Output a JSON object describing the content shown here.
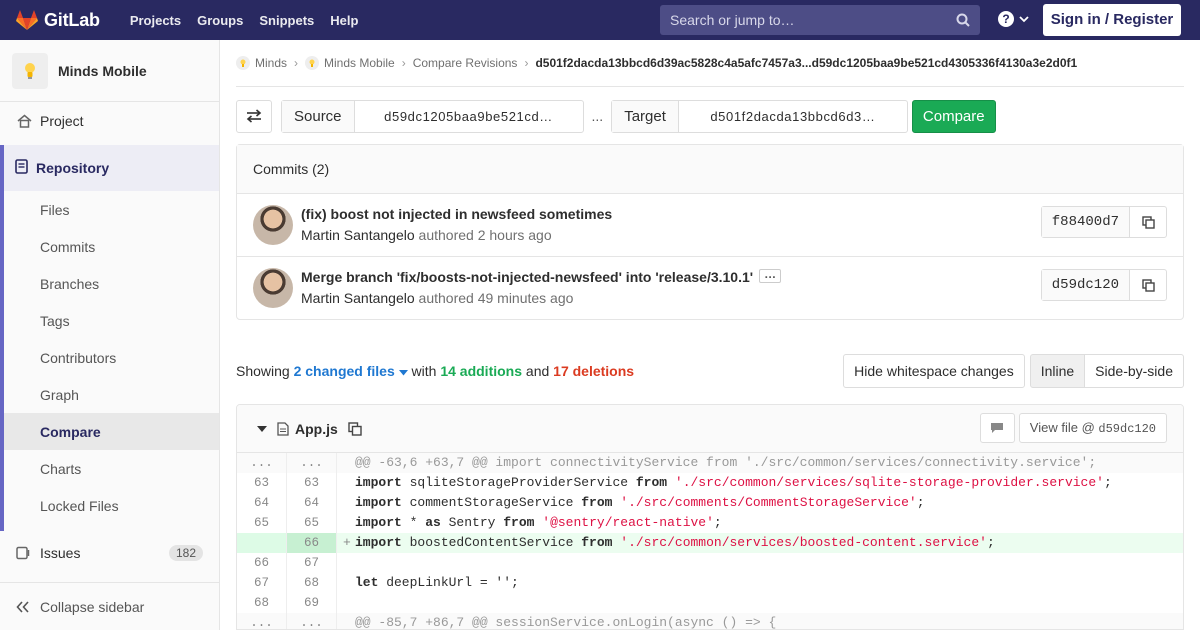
{
  "topbar": {
    "brand": "GitLab",
    "nav": [
      "Projects",
      "Groups",
      "Snippets",
      "Help"
    ],
    "search_placeholder": "Search or jump to…",
    "signin": "Sign in / Register"
  },
  "sidebar": {
    "project_name": "Minds Mobile",
    "project": "Project",
    "repository": "Repository",
    "repo_items": [
      "Files",
      "Commits",
      "Branches",
      "Tags",
      "Contributors",
      "Graph",
      "Compare",
      "Charts",
      "Locked Files"
    ],
    "active_item": "Compare",
    "issues": "Issues",
    "issues_count": "182",
    "collapse": "Collapse sidebar"
  },
  "breadcrumb": [
    "Minds",
    "Minds Mobile",
    "Compare Revisions",
    "d501f2dacda13bbcd6d39ac5828c4a5afc7457a3...d59dc1205baa9be521cd4305336f4130a3e2d0f1"
  ],
  "compare": {
    "source_label": "Source",
    "source_value": "d59dc1205baa9be521cd…",
    "dots": "...",
    "target_label": "Target",
    "target_value": "d501f2dacda13bbcd6d3…",
    "compare_button": "Compare"
  },
  "commits": {
    "header": "Commits (2)",
    "items": [
      {
        "title": "(fix) boost not injected in newsfeed sometimes",
        "author": "Martin Santangelo",
        "authored": "authored 2 hours ago",
        "sha": "f88400d7"
      },
      {
        "title": "Merge branch 'fix/boosts-not-injected-newsfeed' into 'release/3.10.1'",
        "author": "Martin Santangelo",
        "authored": "authored 49 minutes ago",
        "sha": "d59dc120"
      }
    ]
  },
  "stats": {
    "showing": "Showing",
    "changed_files": "2 changed files",
    "with": "with",
    "additions": "14 additions",
    "and": "and",
    "deletions": "17 deletions",
    "hide_ws": "Hide whitespace changes",
    "inline": "Inline",
    "side_by_side": "Side-by-side"
  },
  "file": {
    "name": "App.js",
    "view_file_prefix": "View file @",
    "view_file_sha": "d59dc120",
    "lines": [
      {
        "type": "match",
        "old": "...",
        "new": "...",
        "text": "@@ -63,6 +63,7 @@ import connectivityService from './src/common/services/connectivity.service';"
      },
      {
        "type": "ctx",
        "old": "63",
        "new": "63",
        "kw1": "import",
        "mid": " sqliteStorageProviderService ",
        "kw2": "from",
        "str": "'./src/common/services/sqlite-storage-provider.service'",
        "end": ";"
      },
      {
        "type": "ctx",
        "old": "64",
        "new": "64",
        "kw1": "import",
        "mid": " commentStorageService ",
        "kw2": "from",
        "str": "'./src/comments/CommentStorageService'",
        "end": ";"
      },
      {
        "type": "ctx",
        "old": "65",
        "new": "65",
        "kw1": "import",
        "mid": " * ",
        "kw1b": "as",
        "mid2": " Sentry ",
        "kw2": "from",
        "str": "'@sentry/react-native'",
        "end": ";"
      },
      {
        "type": "add",
        "old": "",
        "new": "66",
        "kw1": "import",
        "mid": " boostedContentService ",
        "kw2": "from",
        "str": "'./src/common/services/boosted-content.service'",
        "end": ";"
      },
      {
        "type": "ctx",
        "old": "66",
        "new": "67",
        "text": ""
      },
      {
        "type": "ctx",
        "old": "67",
        "new": "68",
        "kw1": "let",
        "mid": " deepLinkUrl = '';"
      },
      {
        "type": "ctx",
        "old": "68",
        "new": "69",
        "text": ""
      },
      {
        "type": "match",
        "old": "...",
        "new": "...",
        "text": "@@ -85,7 +86,7 @@ sessionService.onLogin(async () => {"
      }
    ]
  },
  "colors": {
    "navbar": "#292961",
    "accent": "#6666c4",
    "green": "#1aaa55",
    "red": "#db3b21",
    "link": "#1f78d1"
  }
}
